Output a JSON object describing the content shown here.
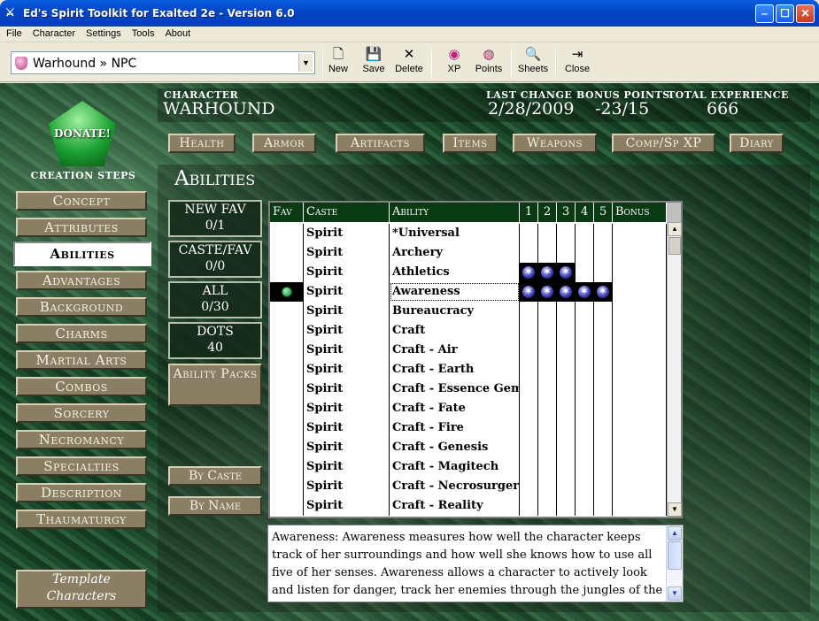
{
  "window": {
    "title": "Ed's Spirit Toolkit for Exalted 2e - Version 6.0"
  },
  "menu": [
    "File",
    "Character",
    "Settings",
    "Tools",
    "About"
  ],
  "toolbar": {
    "combo_value": "Warhound » NPC",
    "buttons": [
      {
        "label": "New",
        "icon": "new-file-icon",
        "glyph": "🗋"
      },
      {
        "label": "Save",
        "icon": "floppy-save-icon",
        "glyph": "💾"
      },
      {
        "label": "Delete",
        "icon": "delete-x-icon",
        "glyph": "✕"
      },
      {
        "label": "XP",
        "icon": "xp-icon",
        "glyph": "◉"
      },
      {
        "label": "Points",
        "icon": "points-icon",
        "glyph": "◍"
      },
      {
        "label": "Sheets",
        "icon": "sheets-magnifier-icon",
        "glyph": "🔍"
      },
      {
        "label": "Close",
        "icon": "close-door-icon",
        "glyph": "⇥"
      }
    ]
  },
  "donate": "DONATE!",
  "creation_steps": {
    "title": "CREATION STEPS",
    "items": [
      "Concept",
      "Attributes",
      "Abilities",
      "Advantages",
      "Background",
      "Charms",
      "Martial Arts",
      "Combos",
      "Sorcery",
      "Necromancy",
      "Specialties",
      "Description",
      "Thaumaturgy"
    ],
    "active": "Abilities"
  },
  "template_button": "Template Characters",
  "character": {
    "label": "CHARACTER",
    "name": "WARHOUND",
    "last_change_label": "LAST CHANGE",
    "last_change": "2/28/2009",
    "bonus_points_label": "BONUS POINTS",
    "bonus_points": "-23/15",
    "total_xp_label": "TOTAL EXPERIENCE",
    "total_xp": "666"
  },
  "top_buttons": [
    "Health",
    "Armor",
    "Artifacts",
    "Items",
    "Weapons",
    "Comp/Sp XP",
    "Diary"
  ],
  "abilities": {
    "title": "Abilities",
    "stats": [
      {
        "label": "NEW FAV",
        "value": "0/1"
      },
      {
        "label": "CASTE/FAV",
        "value": "0/0"
      },
      {
        "label": "ALL",
        "value": "0/30"
      },
      {
        "label": "DOTS",
        "value": "40"
      }
    ],
    "packs_button": "Ability Packs",
    "sort_buttons": [
      "By Caste",
      "By Name"
    ],
    "columns": [
      "Fav",
      "Caste",
      "Ability",
      "1",
      "2",
      "3",
      "4",
      "5",
      "Bonus"
    ],
    "rows": [
      {
        "fav": false,
        "caste": "Spirit",
        "ability": "*Universal",
        "dots": 0
      },
      {
        "fav": false,
        "caste": "Spirit",
        "ability": "Archery",
        "dots": 0
      },
      {
        "fav": false,
        "caste": "Spirit",
        "ability": "Athletics",
        "dots": 3
      },
      {
        "fav": true,
        "caste": "Spirit",
        "ability": "Awareness",
        "dots": 5
      },
      {
        "fav": false,
        "caste": "Spirit",
        "ability": "Bureaucracy",
        "dots": 0
      },
      {
        "fav": false,
        "caste": "Spirit",
        "ability": "Craft",
        "dots": 0
      },
      {
        "fav": false,
        "caste": "Spirit",
        "ability": "Craft - Air",
        "dots": 0
      },
      {
        "fav": false,
        "caste": "Spirit",
        "ability": "Craft - Earth",
        "dots": 0
      },
      {
        "fav": false,
        "caste": "Spirit",
        "ability": "Craft - Essence Gem",
        "dots": 0
      },
      {
        "fav": false,
        "caste": "Spirit",
        "ability": "Craft - Fate",
        "dots": 0
      },
      {
        "fav": false,
        "caste": "Spirit",
        "ability": "Craft - Fire",
        "dots": 0
      },
      {
        "fav": false,
        "caste": "Spirit",
        "ability": "Craft - Genesis",
        "dots": 0
      },
      {
        "fav": false,
        "caste": "Spirit",
        "ability": "Craft - Magitech",
        "dots": 0
      },
      {
        "fav": false,
        "caste": "Spirit",
        "ability": "Craft - Necrosurgery",
        "dots": 0
      },
      {
        "fav": false,
        "caste": "Spirit",
        "ability": "Craft - Reality",
        "dots": 0
      }
    ],
    "selected_row": "Awareness",
    "description": "Awareness:  Awareness measures how well the character keeps track of her surroundings and how well she knows how to use all five of her senses.  Awareness allows a character to actively look and listen for danger, track her enemies through the jungles of the"
  }
}
